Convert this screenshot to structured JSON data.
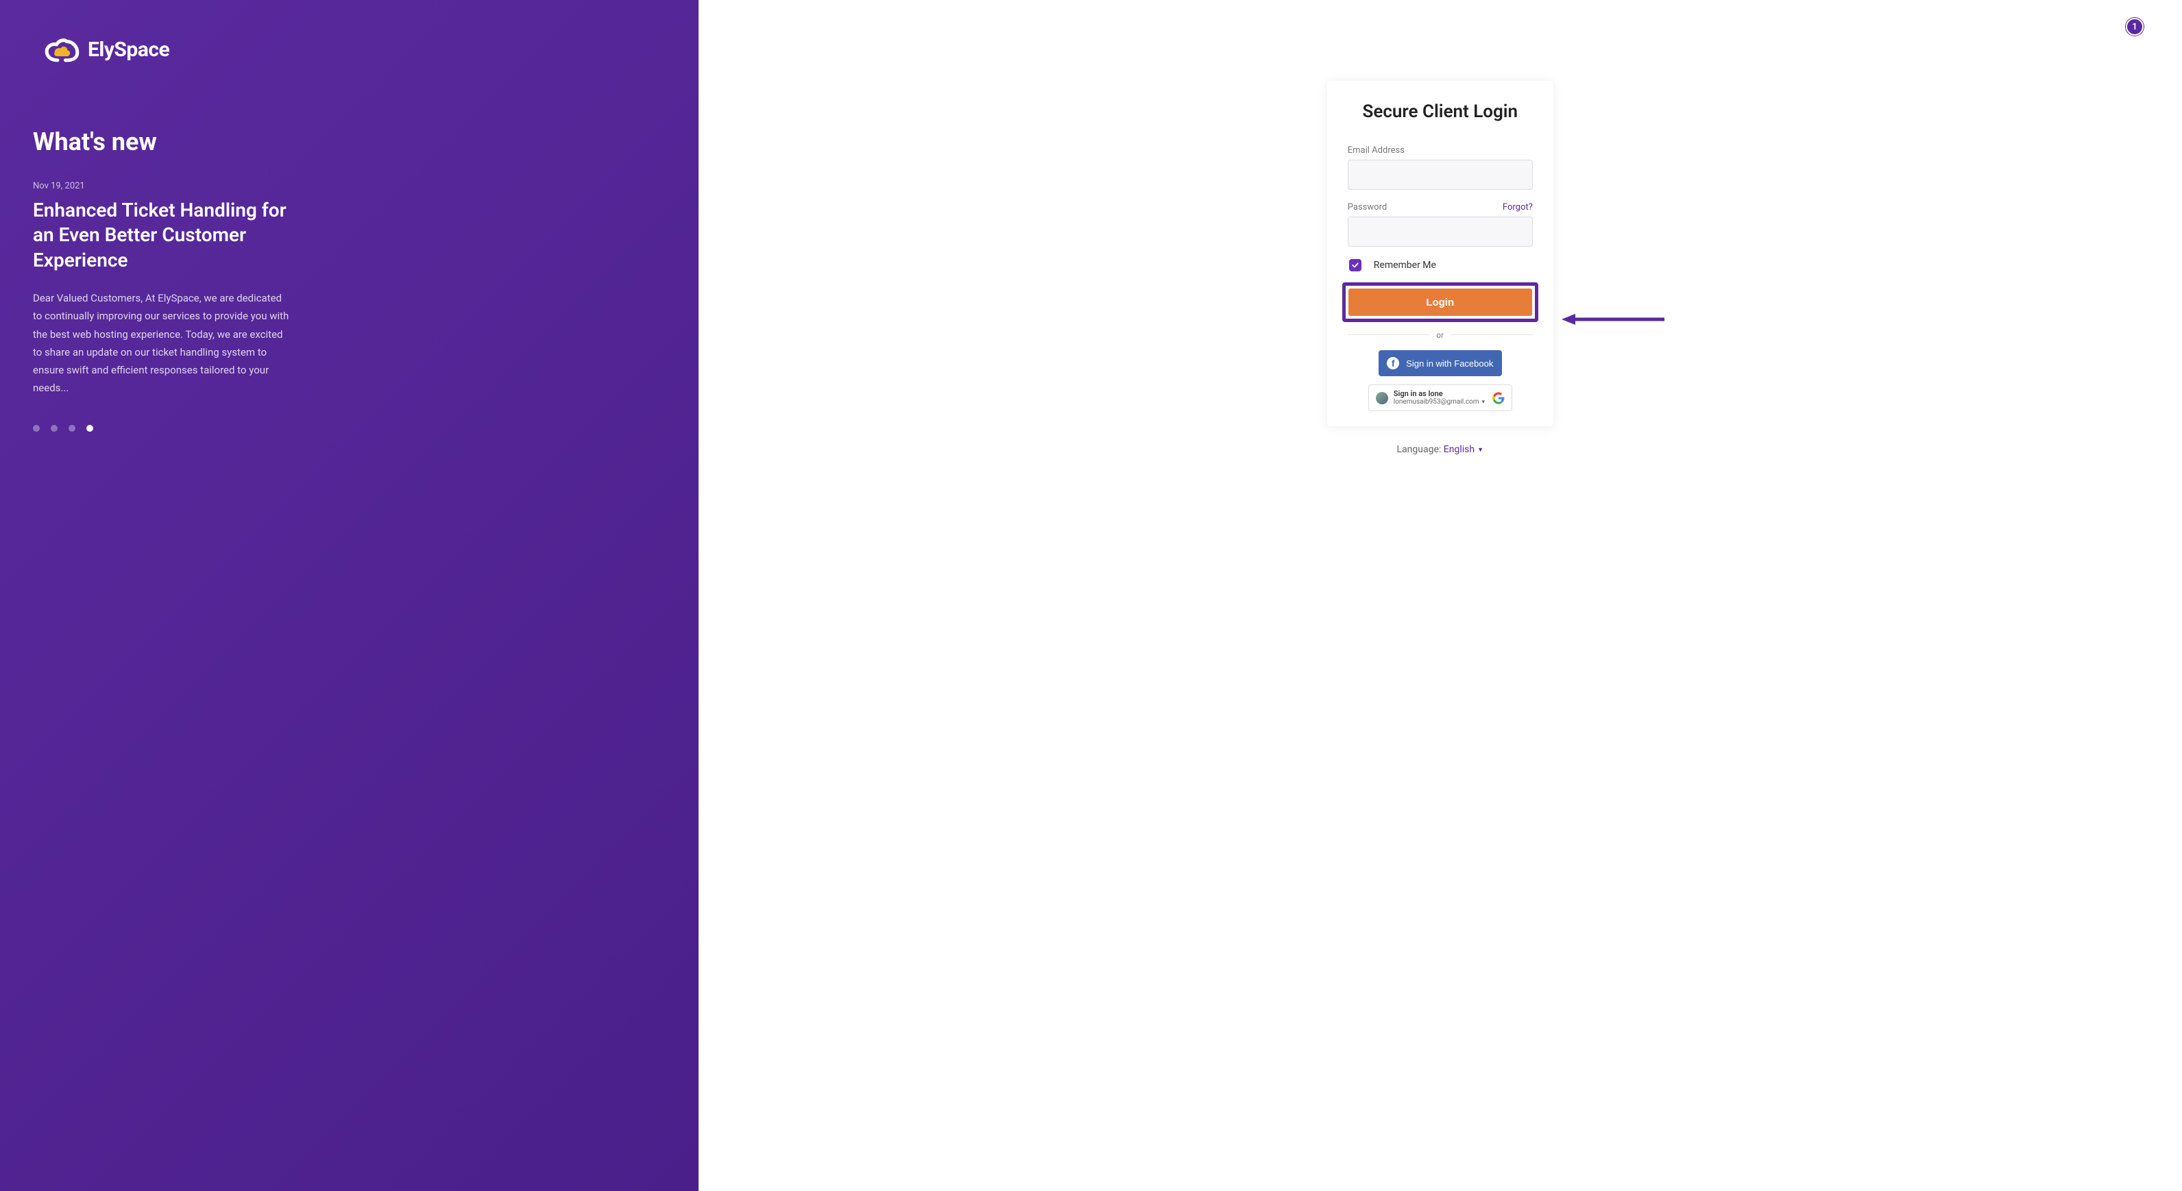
{
  "brand": {
    "name": "ElySpace"
  },
  "sidebar": {
    "whats_new_heading": "What's new",
    "news": {
      "date": "Nov 19, 2021",
      "title": "Enhanced Ticket Handling for an Even Better Customer Experience",
      "body": "Dear Valued Customers, At ElySpace, we are dedicated to continually improving our services to provide you with the best web hosting experience. Today, we are excited to share an update on our ticket handling system to ensure swift and efficient responses tailored to your needs..."
    },
    "carousel": {
      "count": 4,
      "active_index": 3
    }
  },
  "header": {
    "badge_count": "1"
  },
  "login": {
    "title": "Secure Client Login",
    "email_label": "Email Address",
    "email_value": "",
    "password_label": "Password",
    "password_value": "",
    "forgot_label": "Forgot?",
    "remember_label": "Remember Me",
    "remember_checked": true,
    "login_button": "Login",
    "divider_text": "or",
    "facebook_button": "Sign in with Facebook",
    "google": {
      "line1": "Sign in as lone",
      "email": "lonemusaib953@gmail.com"
    }
  },
  "language": {
    "label": "Language:",
    "selected": "English"
  },
  "colors": {
    "brand_purple": "#5a2a9e",
    "accent_orange": "#e67e3a",
    "facebook_blue": "#4267b2"
  }
}
